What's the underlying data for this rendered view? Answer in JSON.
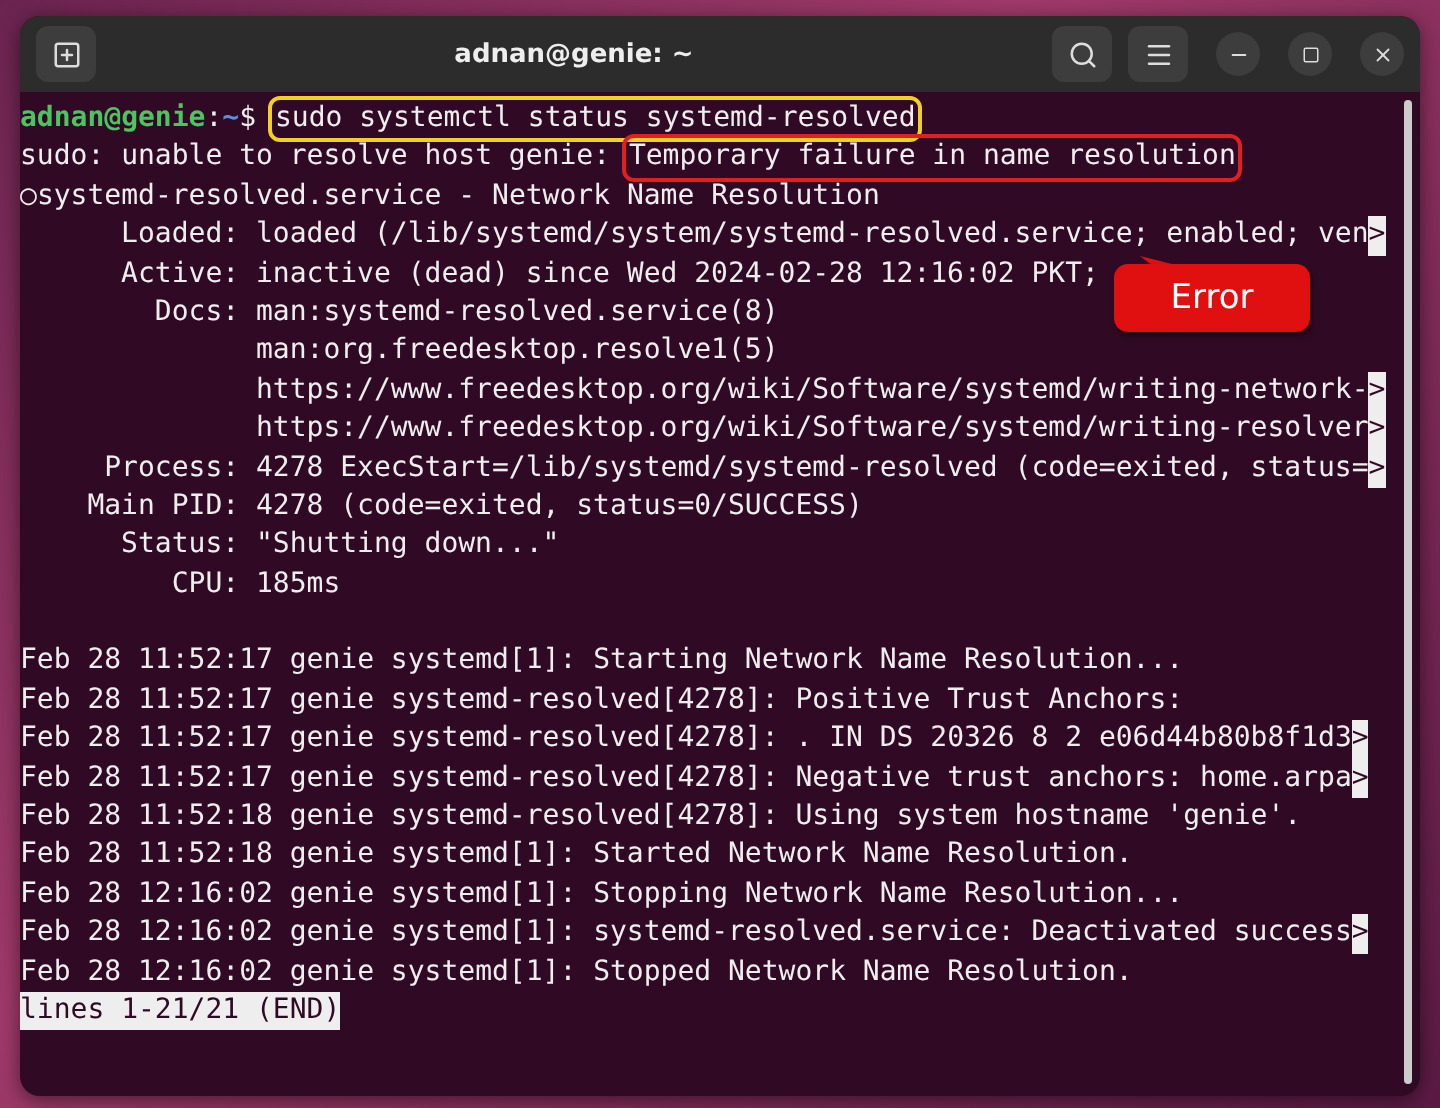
{
  "window": {
    "title": "adnan@genie: ~"
  },
  "prompt": {
    "user_host": "adnan@genie",
    "separator": ":",
    "path": "~",
    "symbol": "$",
    "command": "sudo systemctl status systemd-resolved",
    "highlighted": true
  },
  "warning": {
    "text": "sudo: unable to resolve host genie:",
    "error": "Temporary failure in name resolution",
    "highlighted": true
  },
  "service": {
    "symbol": "○",
    "title": "systemd-resolved.service - Network Name Resolution"
  },
  "properties": [
    {
      "label": "Loaded:",
      "value": "loaded (/lib/systemd/system/systemd-resolved.service; enabled; ven",
      "marker": ">"
    },
    {
      "label": "Active:",
      "value": "inactive (dead) since Wed 2024-02-28 12:16:02 PKT;"
    },
    {
      "label": "Docs:",
      "value": "man:systemd-resolved.service(8)"
    },
    {
      "value": "man:org.freedesktop.resolve1(5)"
    },
    {
      "value": "https://www.freedesktop.org/wiki/Software/systemd/writing-network-",
      "marker": ">"
    },
    {
      "value": "https://www.freedesktop.org/wiki/Software/systemd/writing-resolver",
      "marker": ">"
    },
    {
      "label": "Process:",
      "value": "4278 ExecStart=/lib/systemd/systemd-resolved (code=exited, status=",
      "marker": ">"
    },
    {
      "label": "Main PID:",
      "value": "4278 (code=exited, status=0/SUCCESS)"
    },
    {
      "label": "Status:",
      "value": "\"Shutting down...\""
    },
    {
      "label": "CPU:",
      "value": "185ms"
    }
  ],
  "journal": [
    {
      "text": "Feb 28 11:52:17 genie systemd[1]: Starting Network Name Resolution..."
    },
    {
      "text": "Feb 28 11:52:17 genie systemd-resolved[4278]: Positive Trust Anchors:"
    },
    {
      "text": "Feb 28 11:52:17 genie systemd-resolved[4278]: . IN DS 20326 8 2 e06d44b80b8f1d3",
      "marker": ">"
    },
    {
      "text": "Feb 28 11:52:17 genie systemd-resolved[4278]: Negative trust anchors: home.arpa",
      "marker": ">"
    },
    {
      "text": "Feb 28 11:52:18 genie systemd-resolved[4278]: Using system hostname 'genie'."
    },
    {
      "text": "Feb 28 11:52:18 genie systemd[1]: Started Network Name Resolution."
    },
    {
      "text": "Feb 28 12:16:02 genie systemd[1]: Stopping Network Name Resolution..."
    },
    {
      "text": "Feb 28 12:16:02 genie systemd[1]: systemd-resolved.service: Deactivated success",
      "marker": ">"
    },
    {
      "text": "Feb 28 12:16:02 genie systemd[1]: Stopped Network Name Resolution."
    }
  ],
  "pager_status": "lines 1-21/21 (END)",
  "callout": {
    "label": "Error"
  }
}
